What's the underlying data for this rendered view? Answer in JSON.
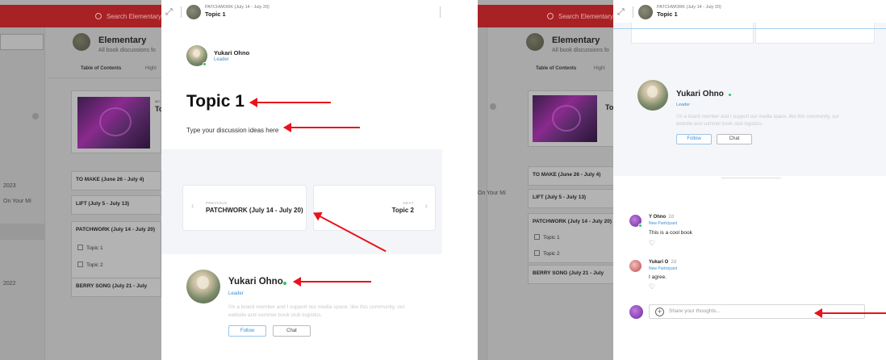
{
  "background_app": {
    "search_placeholder": "Search Elementary",
    "group_title": "Elementary",
    "group_subtitle": "All book discussions fo",
    "tab_contents": "Table of Contents",
    "tab_highlights": "Highl",
    "book_label_small": "MO",
    "book_label": "To",
    "year_2023": "2023",
    "on_your_mind": "On Your Mi",
    "year_2022": "2022",
    "sections": [
      {
        "label": "TO MAKE (June 26 - July 4)"
      },
      {
        "label": "LIFT (July 5 - July 13)"
      },
      {
        "label": "PATCHWORK (July 14 - July 20)"
      },
      {
        "label": "BERRY SONG (July 21 - July"
      }
    ],
    "subtopics": [
      {
        "label": "Topic 1"
      },
      {
        "label": "Topic 2"
      }
    ]
  },
  "drawer_header": {
    "breadcrumb": "PATCHWORK (July 14 - July 20)",
    "title": "Topic 1"
  },
  "left_drawer": {
    "author_name": "Yukari Ohno",
    "author_role": "Leader",
    "topic_title": "Topic 1",
    "topic_description": "Type your discussion ideas here",
    "prev_label": "PREVIOUS",
    "prev_title": "PATCHWORK (July 14 - July 20)",
    "next_label": "NEXT",
    "next_title": "Topic 2",
    "profile_name": "Yukari Ohno",
    "profile_role": "Leader",
    "profile_bio": "I'm a board member and I support our media space, like this community, our website and summer book club logistics.",
    "follow_label": "Follow",
    "chat_label": "Chat"
  },
  "right_drawer": {
    "profile_name": "Yukari Ohno",
    "profile_role": "Leader",
    "profile_bio": "I'm a board member and I support our media space, like this community, our website and summer book club logistics.",
    "follow_label": "Follow",
    "chat_label": "Chat",
    "comments": [
      {
        "author": "Y Ohno",
        "time": "2d",
        "role": "New Participant",
        "text": "This is a cool book"
      },
      {
        "author": "Yukari O",
        "time": "2d",
        "role": "New Participant",
        "text": "I agree."
      }
    ],
    "reply_placeholder": "Share your thoughts..."
  },
  "colors": {
    "brand_red": "#a82124",
    "annotation_arrow": "#e8131b",
    "link_blue": "#3a8fd6",
    "online_green": "#2ec26a"
  }
}
